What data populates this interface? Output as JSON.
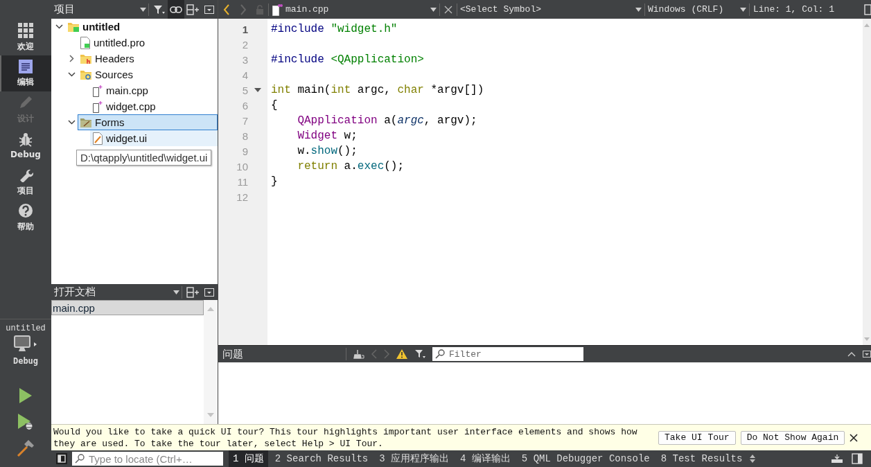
{
  "mode_bar": {
    "modes": [
      {
        "label": "欢迎",
        "kind": "welcome",
        "selected": false,
        "disabled": false
      },
      {
        "label": "编辑",
        "kind": "edit",
        "selected": true,
        "disabled": false
      },
      {
        "label": "设计",
        "kind": "design",
        "selected": false,
        "disabled": true
      },
      {
        "label": "Debug",
        "kind": "debug",
        "selected": false,
        "disabled": false
      },
      {
        "label": "项目",
        "kind": "projects",
        "selected": false,
        "disabled": false
      },
      {
        "label": "帮助",
        "kind": "help",
        "selected": false,
        "disabled": false
      }
    ],
    "target": {
      "project": "untitled",
      "build": "Debug"
    }
  },
  "project_panel": {
    "title": "项目",
    "sync_on": true,
    "tree": [
      {
        "label": "untitled",
        "kind": "project",
        "expanded": true,
        "selected": false,
        "hovered": false,
        "children": [
          {
            "label": "untitled.pro",
            "kind": "pro-file",
            "selected": false,
            "hovered": false
          },
          {
            "label": "Headers",
            "kind": "header-folder",
            "expanded": false,
            "selected": false,
            "hovered": false
          },
          {
            "label": "Sources",
            "kind": "source-folder",
            "expanded": true,
            "selected": false,
            "hovered": false,
            "children": [
              {
                "label": "main.cpp",
                "kind": "source-file",
                "selected": false,
                "hovered": false
              },
              {
                "label": "widget.cpp",
                "kind": "source-file",
                "selected": false,
                "hovered": false
              }
            ]
          },
          {
            "label": "Forms",
            "kind": "form-folder",
            "expanded": true,
            "selected": true,
            "hovered": false,
            "children": [
              {
                "label": "widget.ui",
                "kind": "form-file",
                "selected": false,
                "hovered": true
              }
            ]
          }
        ]
      }
    ],
    "tooltip": "D:\\qtapply\\untitled\\widget.ui"
  },
  "open_documents": {
    "title": "打开文档",
    "items": [
      {
        "label": "main.cpp",
        "selected": true
      }
    ]
  },
  "editor": {
    "file": "main.cpp",
    "symbol": "<Select Symbol>",
    "line_ending": "Windows (CRLF)",
    "position": "Line: 1, Col: 1",
    "lines": [
      {
        "number": "1",
        "current": true,
        "fold_marker": false,
        "tokens": [
          {
            "text": "#include",
            "kind": "preprocessor"
          },
          {
            "text": " \"widget.h\"",
            "kind": "string"
          }
        ]
      },
      {
        "number": "2",
        "current": false,
        "fold_marker": false
      },
      {
        "number": "3",
        "current": false,
        "fold_marker": false,
        "tokens": [
          {
            "text": "#include",
            "kind": "preprocessor"
          },
          {
            "text": " <QApplication>",
            "kind": "string"
          }
        ]
      },
      {
        "number": "4",
        "current": false,
        "fold_marker": false
      },
      {
        "number": "5",
        "current": false,
        "fold_marker": true,
        "tokens": [
          {
            "text": "int",
            "kind": "keyword"
          },
          {
            "text": " main(",
            "kind": "plain"
          },
          {
            "text": "int",
            "kind": "keyword"
          },
          {
            "text": " argc, ",
            "kind": "plain"
          },
          {
            "text": "char",
            "kind": "keyword"
          },
          {
            "text": " *argv[])",
            "kind": "plain"
          }
        ]
      },
      {
        "number": "6",
        "current": false,
        "fold_marker": false,
        "tokens": [
          {
            "text": "{",
            "kind": "plain"
          }
        ]
      },
      {
        "number": "7",
        "current": false,
        "fold_marker": false,
        "tokens": [
          {
            "text": "    QApplication",
            "kind": "type"
          },
          {
            "text": " a(",
            "kind": "plain"
          },
          {
            "text": "argc",
            "kind": "parameter"
          },
          {
            "text": ", argv);",
            "kind": "plain"
          }
        ]
      },
      {
        "number": "8",
        "current": false,
        "fold_marker": false,
        "tokens": [
          {
            "text": "    Widget",
            "kind": "type"
          },
          {
            "text": " w;",
            "kind": "plain"
          }
        ]
      },
      {
        "number": "9",
        "current": false,
        "fold_marker": false,
        "tokens": [
          {
            "text": "    w.",
            "kind": "plain"
          },
          {
            "text": "show",
            "kind": "function"
          },
          {
            "text": "();",
            "kind": "plain"
          }
        ]
      },
      {
        "number": "10",
        "current": false,
        "fold_marker": false,
        "tokens": [
          {
            "text": "    return",
            "kind": "keyword"
          },
          {
            "text": " a.",
            "kind": "plain"
          },
          {
            "text": "exec",
            "kind": "function"
          },
          {
            "text": "();",
            "kind": "plain"
          }
        ]
      },
      {
        "number": "11",
        "current": false,
        "fold_marker": false,
        "tokens": [
          {
            "text": "}",
            "kind": "plain"
          }
        ]
      },
      {
        "number": "12",
        "current": false,
        "fold_marker": false
      }
    ]
  },
  "issues": {
    "title": "问题",
    "filter": {
      "placeholder": "Filter"
    }
  },
  "tour_bar": {
    "message": "Would you like to take a quick UI tour? This tour highlights important user interface elements and shows how they are used. To take the tour later, select Help > UI Tour.",
    "buttons": [
      "Take UI Tour",
      "Do Not Show Again"
    ]
  },
  "status_bar": {
    "locate": {
      "placeholder": "Type to locate (Ctrl+…"
    },
    "tabs": [
      {
        "label": "1 问题",
        "selected": true
      },
      {
        "label": "2 Search Results",
        "selected": false
      },
      {
        "label": "3 应用程序输出",
        "selected": false
      },
      {
        "label": "4 编译输出",
        "selected": false
      },
      {
        "label": "5 QML Debugger Console",
        "selected": false
      },
      {
        "label": "8 Test Results",
        "selected": false
      }
    ]
  }
}
